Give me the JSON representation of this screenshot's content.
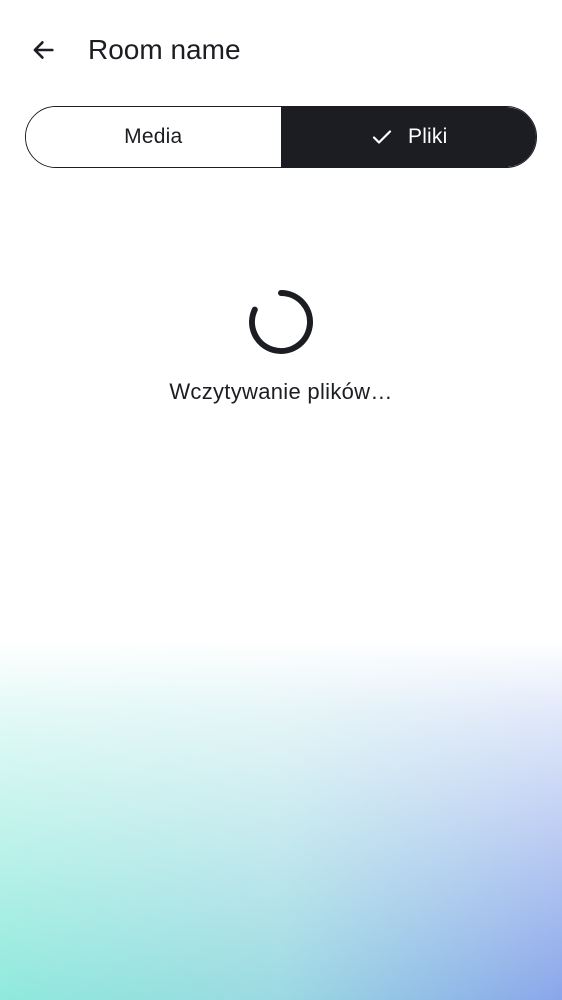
{
  "header": {
    "title": "Room name",
    "back_icon": "arrow-left-icon"
  },
  "tabs": [
    {
      "label": "Media",
      "selected": false
    },
    {
      "label": "Pliki",
      "selected": true,
      "icon": "check-icon"
    }
  ],
  "loading": {
    "text": "Wczytywanie plików…",
    "icon": "spinner-icon"
  },
  "colors": {
    "primary": "#1b1d22",
    "background": "#ffffff",
    "gradient_left": "#8fe9dc",
    "gradient_right": "#8aa6ea"
  }
}
